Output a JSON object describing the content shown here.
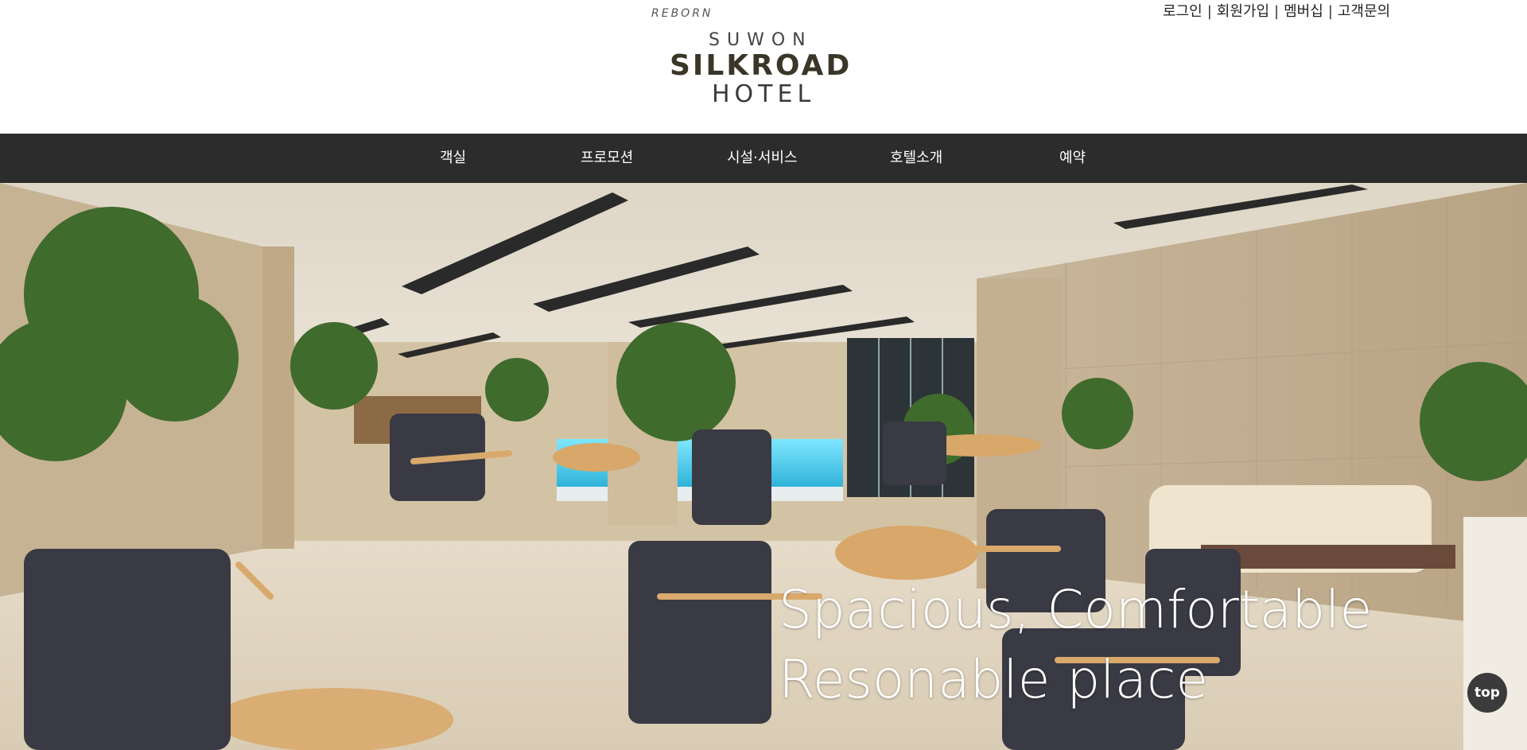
{
  "header": {
    "logo": {
      "reborn": "REBORN",
      "suwon": "SUWON",
      "name": "SILKROAD",
      "hotel": "HOTEL"
    },
    "util_links": [
      "로그인",
      "회원가입",
      "멤버십",
      "고객문의"
    ],
    "separator": "|"
  },
  "nav": {
    "items": [
      "객실",
      "프로모션",
      "시설·서비스",
      "호텔소개",
      "예약"
    ]
  },
  "hero": {
    "line1": "Spacious, Comfortable",
    "line2": "Resonable place"
  },
  "top_button": "top",
  "colors": {
    "nav_bg": "#2c2c2c",
    "logo_dark": "#3a3628",
    "top_button_bg": "#3b3b3b"
  }
}
